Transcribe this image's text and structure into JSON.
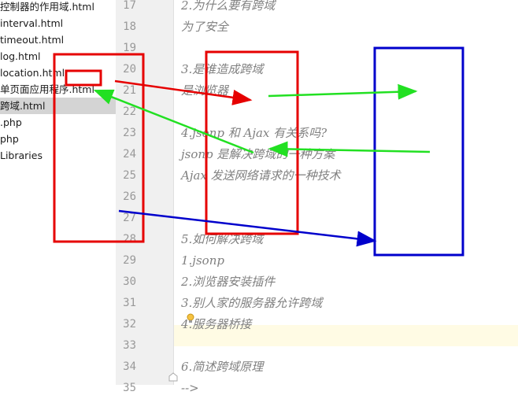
{
  "sidebar": {
    "files": [
      {
        "label": "控制器的作用域.html",
        "selected": false
      },
      {
        "label": "interval.html",
        "selected": false
      },
      {
        "label": "timeout.html",
        "selected": false
      },
      {
        "label": "log.html",
        "selected": false
      },
      {
        "label": "location.html",
        "selected": false
      },
      {
        "label": "单页面应用程序.html",
        "selected": false
      },
      {
        "label": "跨域.html",
        "selected": true
      },
      {
        "label": ".php",
        "selected": false
      },
      {
        "label": "php",
        "selected": false
      },
      {
        "label": "Libraries",
        "selected": false
      }
    ]
  },
  "editor": {
    "current_line": "33",
    "lines": [
      {
        "num": "17",
        "text": "2.为什么要有跨域"
      },
      {
        "num": "18",
        "text": "为了安全"
      },
      {
        "num": "19",
        "text": ""
      },
      {
        "num": "20",
        "text": "3.是谁造成跨域"
      },
      {
        "num": "21",
        "text": "是浏览器"
      },
      {
        "num": "22",
        "text": ""
      },
      {
        "num": "23",
        "text": "4.jsonp 和 Ajax 有关系吗?"
      },
      {
        "num": "24",
        "text": "jsonp 是解决跨域的一种方案"
      },
      {
        "num": "25",
        "text": "Ajax 发送网络请求的一种技术"
      },
      {
        "num": "26",
        "text": ""
      },
      {
        "num": "27",
        "text": ""
      },
      {
        "num": "28",
        "text": "5.如何解决跨域"
      },
      {
        "num": "29",
        "text": "1.jsonp"
      },
      {
        "num": "30",
        "text": "2.浏览器安装插件"
      },
      {
        "num": "31",
        "text": "3.别人家的服务器允许跨域"
      },
      {
        "num": "32",
        "text": "4.服务器桥接"
      },
      {
        "num": "33",
        "text": ""
      },
      {
        "num": "34",
        "text": "6.简述跨域原理"
      },
      {
        "num": "35",
        "text": "-->"
      }
    ]
  },
  "colors": {
    "red_annotation": "#e60000",
    "green_annotation": "#22e022",
    "blue_annotation": "#0000cc",
    "comment_text": "#808080",
    "line_number": "#999999",
    "current_line_bg": "#fffbe4",
    "selected_file_bg": "#d4d4d4"
  },
  "icons": {
    "bulb": "lightbulb-icon",
    "fold": "fold-marker-icon"
  }
}
